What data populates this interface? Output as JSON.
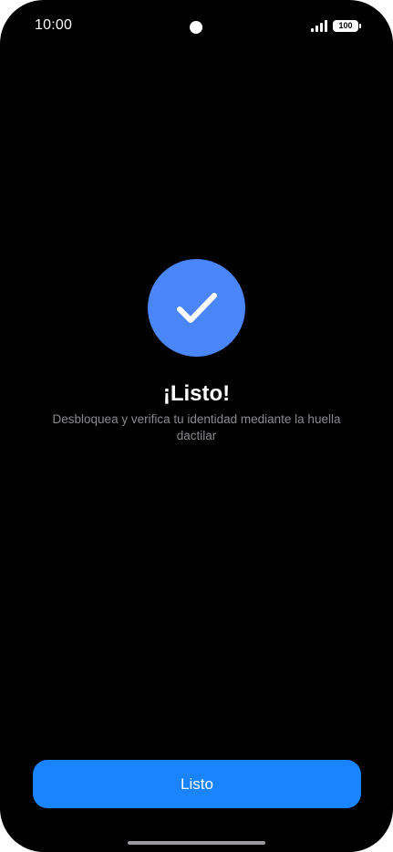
{
  "status_bar": {
    "time": "10:00",
    "battery_level": "100",
    "signal_icon": "cellular-signal-icon"
  },
  "content": {
    "icon": "checkmark-icon",
    "title": "¡Listo!",
    "subtitle": "Desbloquea y verifica tu identidad mediante la huella dactilar"
  },
  "actions": {
    "done_label": "Listo"
  },
  "colors": {
    "background": "#000000",
    "check_circle": "#4a86f7",
    "primary_button": "#1a84ff",
    "subtitle_text": "#8a8a8e"
  }
}
